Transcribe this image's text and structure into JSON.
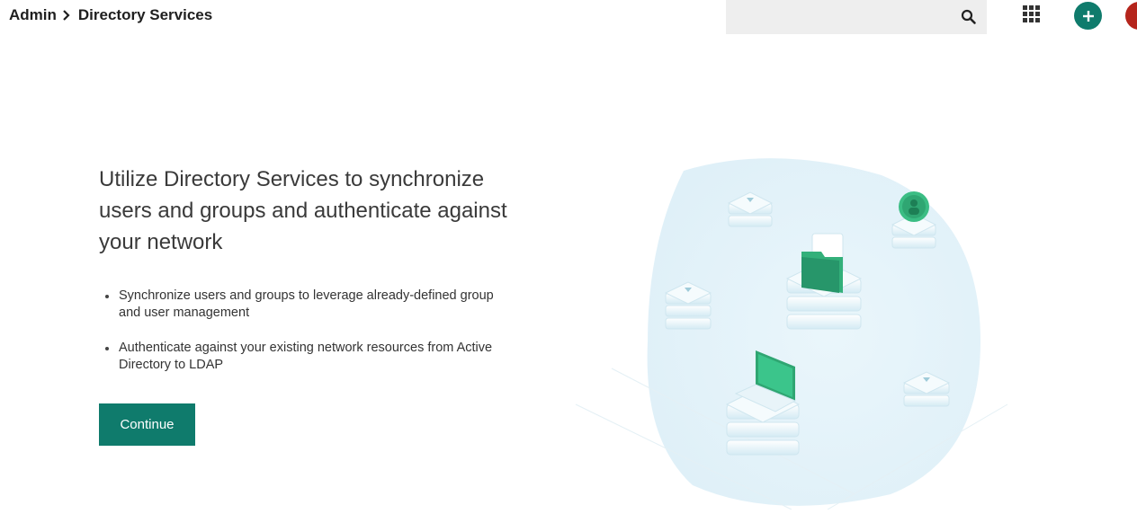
{
  "header": {
    "breadcrumb": [
      "Admin",
      "Directory Services"
    ],
    "search": {
      "placeholder": "",
      "value": ""
    },
    "icons": [
      "search-icon",
      "apps-grid-icon",
      "plus-icon"
    ]
  },
  "main": {
    "headline": "Utilize Directory Services to synchronize users and groups and authenticate against your network",
    "bullets": [
      "Synchronize users and groups to leverage already-defined group and user management",
      "Authenticate against your existing network resources from Active Directory to LDAP"
    ],
    "continue_label": "Continue"
  },
  "colors": {
    "accent": "#0f7b6c",
    "avatar": "#b5251c",
    "search_bg": "#eeeeee"
  }
}
